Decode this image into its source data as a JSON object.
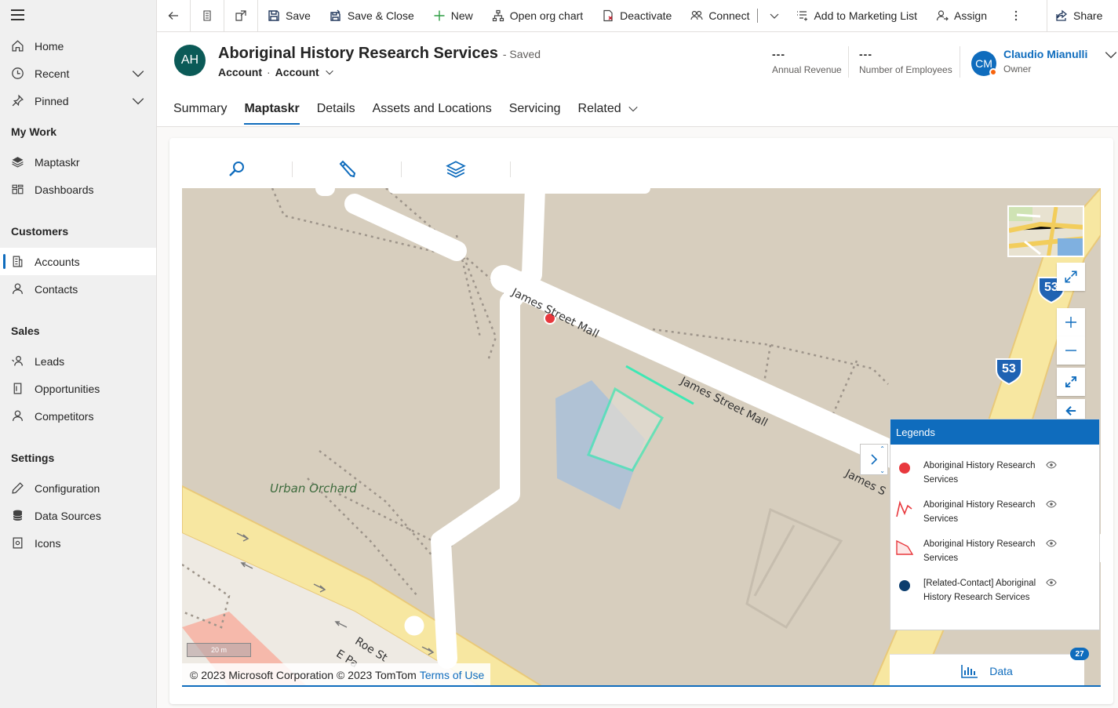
{
  "sidebar": {
    "items": [
      {
        "label": "Home",
        "icon": "home-icon"
      },
      {
        "label": "Recent",
        "icon": "clock-icon"
      },
      {
        "label": "Pinned",
        "icon": "pin-icon"
      }
    ],
    "groups": {
      "my_work": "My Work",
      "customers": "Customers",
      "sales": "Sales",
      "settings": "Settings"
    },
    "my_work_items": [
      {
        "label": "Maptaskr"
      },
      {
        "label": "Dashboards"
      }
    ],
    "customer_items": [
      {
        "label": "Accounts"
      },
      {
        "label": "Contacts"
      }
    ],
    "sales_items": [
      {
        "label": "Leads"
      },
      {
        "label": "Opportunities"
      },
      {
        "label": "Competitors"
      }
    ],
    "settings_items": [
      {
        "label": "Configuration"
      },
      {
        "label": "Data Sources"
      },
      {
        "label": "Icons"
      }
    ]
  },
  "toolbar": {
    "save": "Save",
    "save_close": "Save & Close",
    "new": "New",
    "org_chart": "Open org chart",
    "deactivate": "Deactivate",
    "connect": "Connect",
    "marketing": "Add to Marketing List",
    "assign": "Assign",
    "share": "Share"
  },
  "record": {
    "initials": "AH",
    "title": "Aboriginal History Research Services",
    "saved": "- Saved",
    "entity": "Account",
    "form": "Account",
    "annual_revenue_value": "---",
    "annual_revenue_label": "Annual Revenue",
    "employees_value": "---",
    "employees_label": "Number of Employees",
    "owner_initials": "CM",
    "owner_name": "Claudio Mianulli",
    "owner_role": "Owner"
  },
  "tabs": [
    "Summary",
    "Maptaskr",
    "Details",
    "Assets and Locations",
    "Servicing",
    "Related"
  ],
  "map": {
    "street_1": "James Street Mall",
    "street_2": "James Street Mall",
    "street_3": "James S",
    "place": "Urban Orchard",
    "road": "Roe St",
    "road_2": "E Pa",
    "highway_shield": "53",
    "highway_shield_2": "53",
    "scale": "20 m",
    "copyright": "© 2023 Microsoft Corporation © 2023 TomTom",
    "terms": "Terms of Use"
  },
  "legend": {
    "title": "Legends",
    "items": [
      {
        "label": "Aboriginal History Research Services",
        "symbol": "red-point",
        "color": "#e8383d"
      },
      {
        "label": "Aboriginal History Research Services",
        "symbol": "red-line",
        "color": "#e8383d"
      },
      {
        "label": "Aboriginal History Research Services",
        "symbol": "red-polygon",
        "color": "#e8383d"
      },
      {
        "label": "[Related-Contact] Aboriginal History Research Services",
        "symbol": "navy-point",
        "color": "#0b3d6e"
      }
    ]
  },
  "data_panel": {
    "label": "Data",
    "count": "27"
  }
}
